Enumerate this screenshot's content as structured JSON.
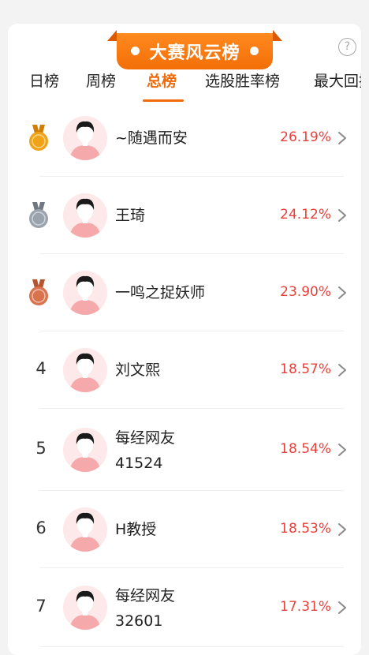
{
  "header": {
    "title": "大赛风云榜",
    "help_label": "?"
  },
  "tabs": [
    {
      "label": "日榜",
      "active": false
    },
    {
      "label": "周榜",
      "active": false
    },
    {
      "label": "总榜",
      "active": true
    },
    {
      "label": "选股胜率榜",
      "active": false
    },
    {
      "label": "最大回撤",
      "active": false
    }
  ],
  "colors": {
    "accent": "#f06b0a",
    "percent": "#e8413c",
    "gold": "#f0a316",
    "silver": "#9aa3ad",
    "bronze": "#d9734e"
  },
  "rows": [
    {
      "rank": "1",
      "medal": "gold",
      "name_lines": [
        "~随遇而安"
      ],
      "percent": "26.19%"
    },
    {
      "rank": "2",
      "medal": "silver",
      "name_lines": [
        "王琦"
      ],
      "percent": "24.12%"
    },
    {
      "rank": "3",
      "medal": "bronze",
      "name_lines": [
        "一鸣之捉妖师"
      ],
      "percent": "23.90%"
    },
    {
      "rank": "4",
      "medal": "",
      "name_lines": [
        "刘文熙"
      ],
      "percent": "18.57%"
    },
    {
      "rank": "5",
      "medal": "",
      "name_lines": [
        "每经网友",
        "41524"
      ],
      "percent": "18.54%"
    },
    {
      "rank": "6",
      "medal": "",
      "name_lines": [
        "H教授"
      ],
      "percent": "18.53%"
    },
    {
      "rank": "7",
      "medal": "",
      "name_lines": [
        "每经网友",
        "32601"
      ],
      "percent": "17.31%"
    }
  ]
}
